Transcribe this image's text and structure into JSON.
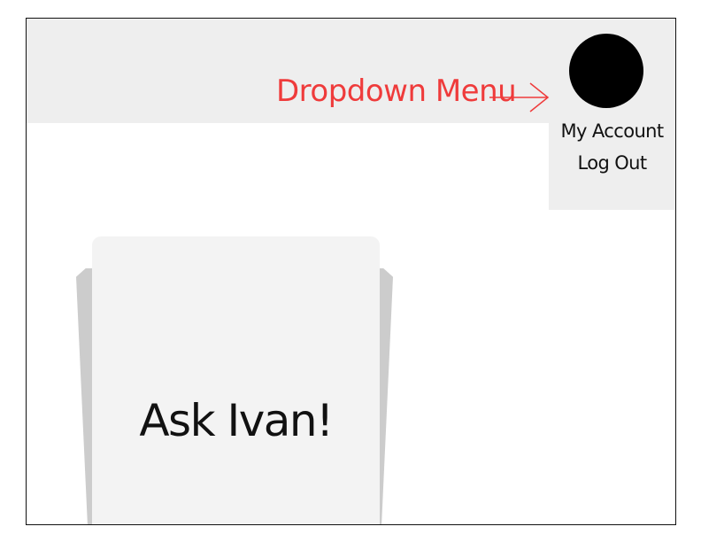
{
  "annotation": {
    "text": "Dropdown Menu",
    "color": "#ef3b3b"
  },
  "user_menu": {
    "avatar_icon": "user-avatar-circle",
    "items": [
      {
        "label": "My Account"
      },
      {
        "label": "Log Out"
      }
    ]
  },
  "card": {
    "label": "Ask Ivan!"
  }
}
